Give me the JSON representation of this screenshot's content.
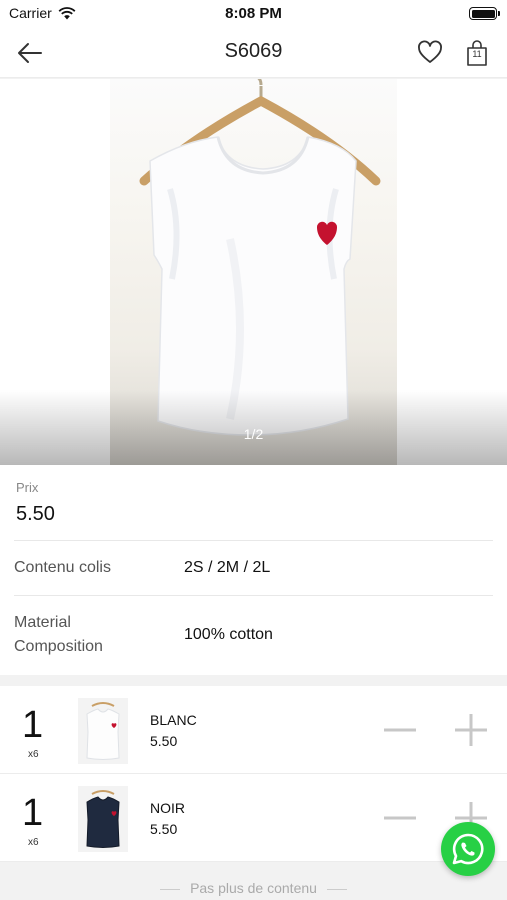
{
  "status_bar": {
    "carrier": "Carrier",
    "time": "8:08 PM"
  },
  "nav": {
    "title": "S6069",
    "cart_count": "11",
    "icons": [
      "back-arrow-icon",
      "heart-icon",
      "shopping-bag-icon"
    ]
  },
  "gallery": {
    "page_indicator": "1/2",
    "current_page": 1,
    "total_pages": 2
  },
  "product": {
    "price_label": "Prix",
    "price_value": "5.50",
    "package_label": "Contenu colis",
    "package_value": "2S / 2M / 2L",
    "material_label_line1": "Material",
    "material_label_line2": "Composition",
    "material_value": "100% cotton"
  },
  "variants": [
    {
      "qty": "1",
      "multiplier": "x6",
      "name": "BLANC",
      "price": "5.50",
      "color": "#ffffff"
    },
    {
      "qty": "1",
      "multiplier": "x6",
      "name": "NOIR",
      "price": "5.50",
      "color": "#1f2a3f"
    }
  ],
  "footer": {
    "end_text": "Pas plus de contenu"
  },
  "colors": {
    "whatsapp": "#27d045",
    "heart_patch": "#c4122f",
    "control_gray": "#c7c7c7"
  }
}
